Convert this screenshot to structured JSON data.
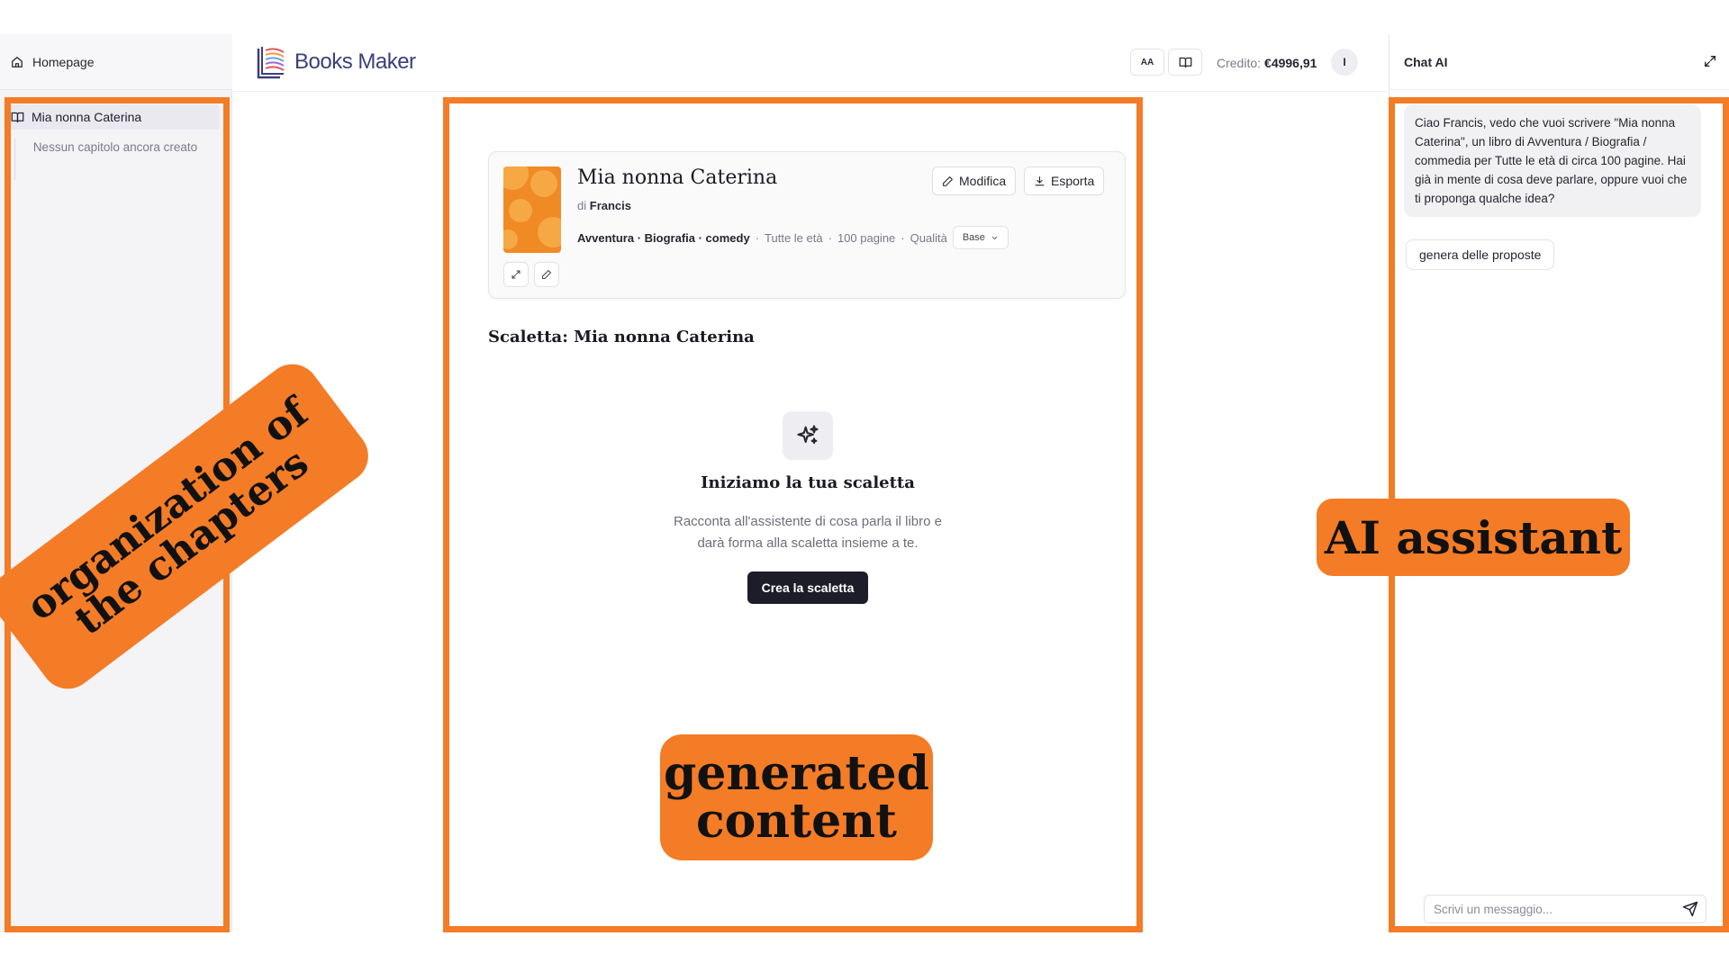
{
  "sidebar": {
    "home_label": "Homepage",
    "book_label": "Mia nonna Caterina",
    "empty_text": "Nessun capitolo ancora creato"
  },
  "header": {
    "logo_text": "Books Maker",
    "font_button": "AA",
    "credit_label": "Credito:",
    "credit_value": "€4996,91",
    "avatar_initial": "I"
  },
  "book": {
    "title": "Mia nonna Caterina",
    "author_prefix": "di",
    "author": "Francis",
    "genres": "Avventura · Biografia · comedy",
    "sep": "·",
    "age": "Tutte le età",
    "pages": "100 pagine",
    "quality_label": "Qualità",
    "quality_value": "Base",
    "edit_label": "Modifica",
    "export_label": "Esporta"
  },
  "outline": {
    "title": "Scaletta: Mia nonna Caterina",
    "empty_title": "Iniziamo la tua scaletta",
    "empty_desc": "Racconta all'assistente di cosa parla il libro e darà forma alla scaletta insieme a te.",
    "create_button": "Crea la scaletta"
  },
  "chat": {
    "title": "Chat AI",
    "message": "Ciao Francis, vedo che vuoi scrivere \"Mia nonna Caterina\", un libro di Avventura / Biografia / commedia per Tutte le età di circa 100 pagine. Hai già in mente di cosa deve parlare, oppure vuoi che ti proponga qualche idea?",
    "suggestion": "genera delle proposte",
    "input_placeholder": "Scrivi un messaggio..."
  },
  "annotations": {
    "left_line1": "organization of",
    "left_line2": "the chapters",
    "center_line1": "generated",
    "center_line2": "content",
    "right": "AI assistant",
    "color": "#f47c26"
  }
}
